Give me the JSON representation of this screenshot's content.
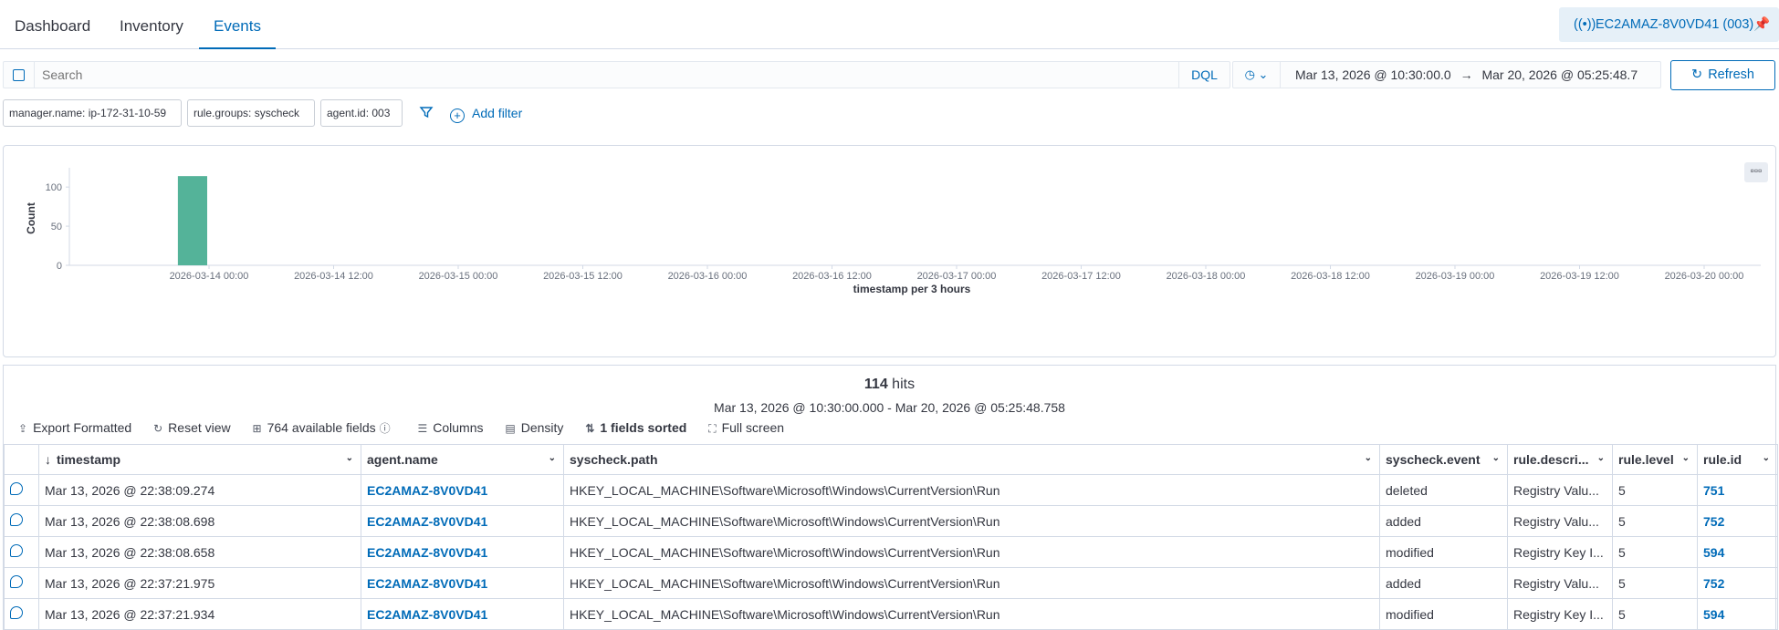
{
  "tabs": [
    {
      "label": "Dashboard"
    },
    {
      "label": "Inventory"
    },
    {
      "label": "Events",
      "active": true
    }
  ],
  "agent_badge": "EC2AMAZ-8V0VD41 (003)",
  "search": {
    "placeholder": "Search",
    "language": "DQL"
  },
  "date_range": {
    "start": "Mar 13, 2026 @ 10:30:00.0",
    "arrow": "→",
    "end": "Mar 20, 2026 @ 05:25:48.7"
  },
  "refresh_label": "Refresh",
  "filters": [
    "manager.name: ip-172-31-10-59",
    "rule.groups: syscheck",
    "agent.id: 003"
  ],
  "add_filter_label": "Add filter",
  "chart_data": {
    "type": "bar",
    "ylabel": "Count",
    "xlabel": "timestamp per 3 hours",
    "yticks": [
      0,
      50,
      100
    ],
    "ylim": [
      0,
      120
    ],
    "xticks": [
      "2026-03-14 00:00",
      "2026-03-14 12:00",
      "2026-03-15 00:00",
      "2026-03-15 12:00",
      "2026-03-16 00:00",
      "2026-03-16 12:00",
      "2026-03-17 00:00",
      "2026-03-17 12:00",
      "2026-03-18 00:00",
      "2026-03-18 12:00",
      "2026-03-19 00:00",
      "2026-03-19 12:00",
      "2026-03-20 00:00"
    ],
    "bars": [
      {
        "x": "2026-03-13 21:00",
        "value": 114
      }
    ],
    "bar_color": "#54b399"
  },
  "hits": {
    "count": "114",
    "label": "hits",
    "range": "Mar 13, 2026 @ 10:30:00.000 - Mar 20, 2026 @ 05:25:48.758"
  },
  "toolbar": {
    "export": "Export Formatted",
    "reset": "Reset view",
    "fields": "764 available fields",
    "columns": "Columns",
    "density": "Density",
    "sorted": "1 fields sorted",
    "fullscreen": "Full screen"
  },
  "table": {
    "columns": [
      "timestamp",
      "agent.name",
      "syscheck.path",
      "syscheck.event",
      "rule.descri...",
      "rule.level",
      "rule.id"
    ],
    "rows": [
      [
        "Mar 13, 2026 @ 22:38:09.274",
        "EC2AMAZ-8V0VD41",
        "HKEY_LOCAL_MACHINE\\Software\\Microsoft\\Windows\\CurrentVersion\\Run",
        "deleted",
        "Registry Valu...",
        "5",
        "751"
      ],
      [
        "Mar 13, 2026 @ 22:38:08.698",
        "EC2AMAZ-8V0VD41",
        "HKEY_LOCAL_MACHINE\\Software\\Microsoft\\Windows\\CurrentVersion\\Run",
        "added",
        "Registry Valu...",
        "5",
        "752"
      ],
      [
        "Mar 13, 2026 @ 22:38:08.658",
        "EC2AMAZ-8V0VD41",
        "HKEY_LOCAL_MACHINE\\Software\\Microsoft\\Windows\\CurrentVersion\\Run",
        "modified",
        "Registry Key I...",
        "5",
        "594"
      ],
      [
        "Mar 13, 2026 @ 22:37:21.975",
        "EC2AMAZ-8V0VD41",
        "HKEY_LOCAL_MACHINE\\Software\\Microsoft\\Windows\\CurrentVersion\\Run",
        "added",
        "Registry Valu...",
        "5",
        "752"
      ],
      [
        "Mar 13, 2026 @ 22:37:21.934",
        "EC2AMAZ-8V0VD41",
        "HKEY_LOCAL_MACHINE\\Software\\Microsoft\\Windows\\CurrentVersion\\Run",
        "modified",
        "Registry Key I...",
        "5",
        "594"
      ]
    ]
  }
}
